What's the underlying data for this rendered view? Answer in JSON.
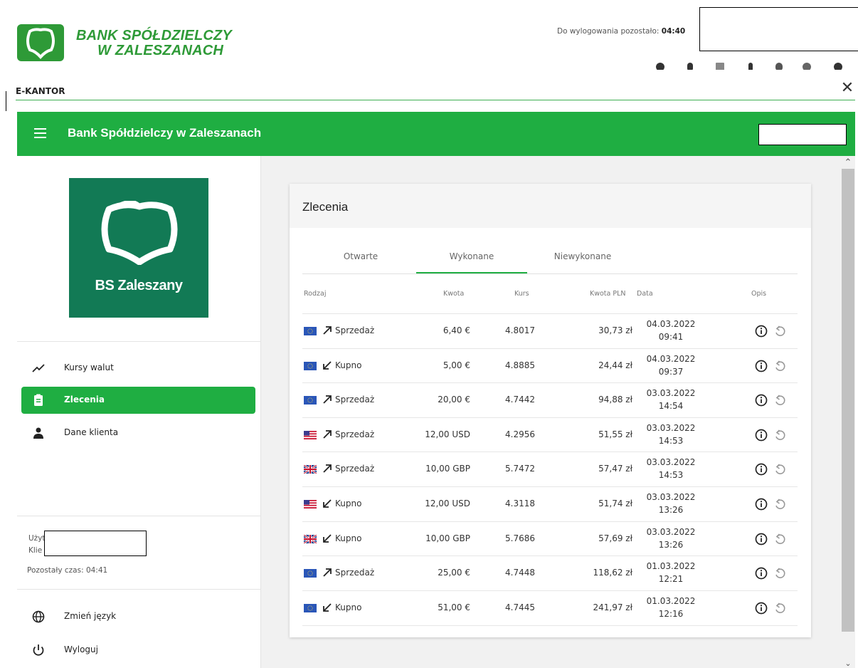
{
  "bank": {
    "name_line1": "BANK SPÓŁDZIELCZY",
    "name_line2": "W ZALESZANACH"
  },
  "session": {
    "logout_label": "Do wylogowania pozostało:",
    "logout_time": "04:40"
  },
  "window": {
    "title": "E-KANTOR",
    "close_glyph": "✕"
  },
  "appbar": {
    "title": "Bank Spółdzielczy w Zaleszanach",
    "menu_icon": "hamburger-icon"
  },
  "sidebar": {
    "logo_text": "BS Zaleszany",
    "items": [
      {
        "label": "Kursy walut",
        "icon": "trending-icon",
        "active": false
      },
      {
        "label": "Zlecenia",
        "icon": "clipboard-icon",
        "active": true
      },
      {
        "label": "Dane klienta",
        "icon": "person-icon",
        "active": false
      }
    ],
    "user_label": "Użyt",
    "client_label": "Klie",
    "remaining_time": "Pozostały czas: 04:41",
    "bottom_items": [
      {
        "label": "Zmień język",
        "icon": "globe-icon"
      },
      {
        "label": "Wyloguj",
        "icon": "power-icon"
      }
    ]
  },
  "orders": {
    "title": "Zlecenia",
    "tabs": [
      "Otwarte",
      "Wykonane",
      "Niewykonane"
    ],
    "active_tab": "Wykonane",
    "columns": {
      "type": "Rodzaj",
      "amount": "Kwota",
      "rate": "Kurs",
      "amount_pln": "Kwota PLN",
      "date": "Data",
      "description": "Opis"
    },
    "rows": [
      {
        "currency": "EUR",
        "type": "Sprzedaż",
        "direction": "sell",
        "amount": "6,40 €",
        "rate": "4.8017",
        "amount_pln": "30,73 zł",
        "date": "04.03.2022",
        "time": "09:41"
      },
      {
        "currency": "EUR",
        "type": "Kupno",
        "direction": "buy",
        "amount": "5,00 €",
        "rate": "4.8885",
        "amount_pln": "24,44 zł",
        "date": "04.03.2022",
        "time": "09:37"
      },
      {
        "currency": "EUR",
        "type": "Sprzedaż",
        "direction": "sell",
        "amount": "20,00 €",
        "rate": "4.7442",
        "amount_pln": "94,88 zł",
        "date": "03.03.2022",
        "time": "14:54"
      },
      {
        "currency": "USD",
        "type": "Sprzedaż",
        "direction": "sell",
        "amount": "12,00 USD",
        "rate": "4.2956",
        "amount_pln": "51,55 zł",
        "date": "03.03.2022",
        "time": "14:53"
      },
      {
        "currency": "GBP",
        "type": "Sprzedaż",
        "direction": "sell",
        "amount": "10,00 GBP",
        "rate": "5.7472",
        "amount_pln": "57,47 zł",
        "date": "03.03.2022",
        "time": "14:53"
      },
      {
        "currency": "USD",
        "type": "Kupno",
        "direction": "buy",
        "amount": "12,00 USD",
        "rate": "4.3118",
        "amount_pln": "51,74 zł",
        "date": "03.03.2022",
        "time": "13:26"
      },
      {
        "currency": "GBP",
        "type": "Kupno",
        "direction": "buy",
        "amount": "10,00 GBP",
        "rate": "5.7686",
        "amount_pln": "57,69 zł",
        "date": "03.03.2022",
        "time": "13:26"
      },
      {
        "currency": "EUR",
        "type": "Sprzedaż",
        "direction": "sell",
        "amount": "25,00 €",
        "rate": "4.7448",
        "amount_pln": "118,62 zł",
        "date": "01.03.2022",
        "time": "12:21"
      },
      {
        "currency": "EUR",
        "type": "Kupno",
        "direction": "buy",
        "amount": "51,00 €",
        "rate": "4.7445",
        "amount_pln": "241,97 zł",
        "date": "01.03.2022",
        "time": "12:16"
      }
    ]
  },
  "colors": {
    "brand_green": "#1fae42",
    "logo_green": "#127a55",
    "bank_text_green": "#2e9a37"
  }
}
